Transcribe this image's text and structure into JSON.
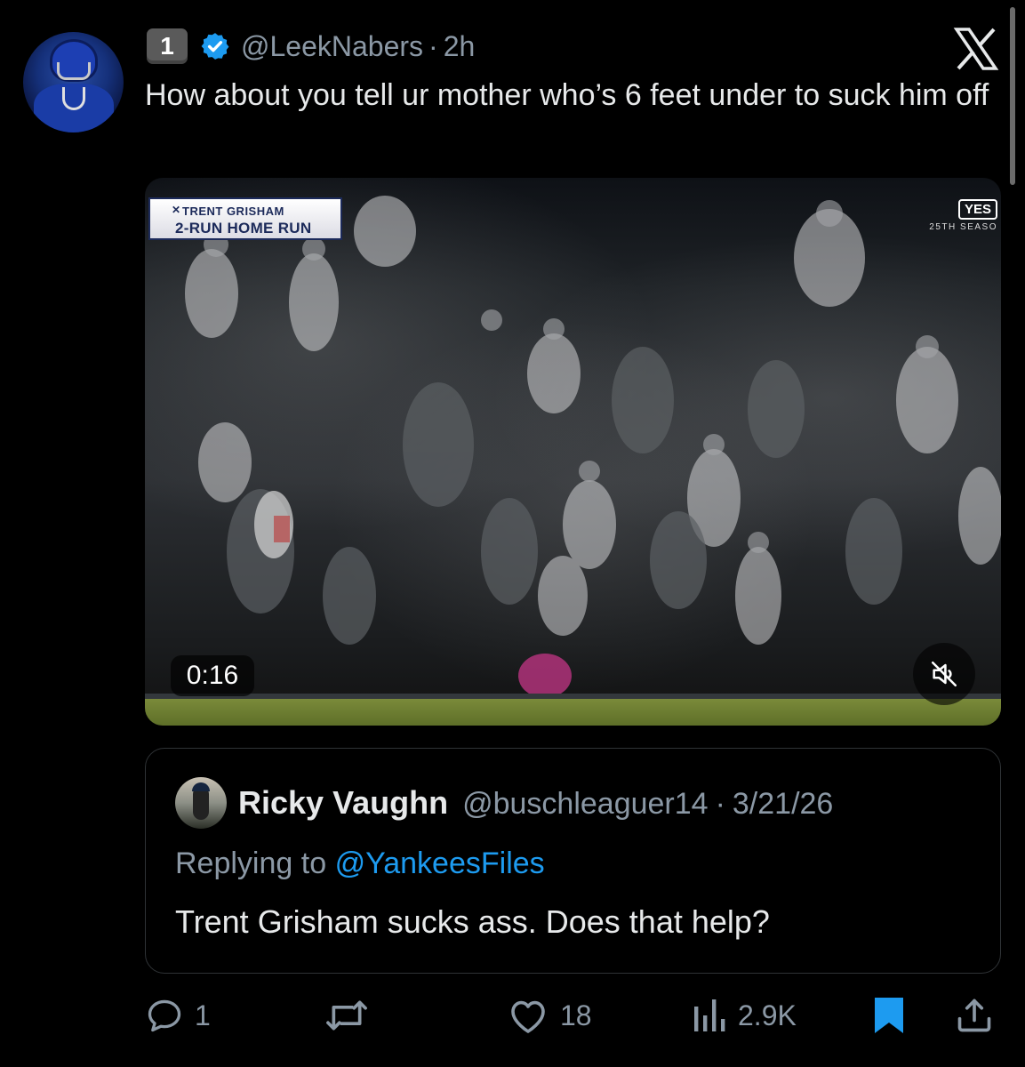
{
  "tweet": {
    "rank_badge": "1",
    "handle": "@LeekNabers",
    "separator": "·",
    "time": "2h",
    "text": "How about you tell ur mother who’s 6 feet under to suck him off"
  },
  "video": {
    "lower_third_line1": "TRENT GRISHAM",
    "lower_third_line2": "2-RUN HOME RUN",
    "network_logo": "YES",
    "network_sub": "25TH SEASO",
    "duration": "0:16"
  },
  "quote": {
    "name": "Ricky Vaughn",
    "handle": "@buschleaguer14",
    "separator": "·",
    "date": "3/21/26",
    "replying_prefix": "Replying to",
    "replying_to": "@YankeesFiles",
    "text": "Trent Grisham sucks ass.  Does that help?"
  },
  "actions": {
    "replies": "1",
    "likes": "18",
    "views": "2.9K"
  },
  "colors": {
    "background": "#000000",
    "text": "#e7e9ea",
    "muted": "#8b98a5",
    "accent": "#1d9bf0",
    "bookmark": "#1d9bf0",
    "verified": "#1d9bf0"
  },
  "icons": [
    "rank-badge",
    "verified-icon",
    "x-logo-icon",
    "mute-icon",
    "reply-icon",
    "retweet-icon",
    "like-icon",
    "views-icon",
    "bookmark-icon",
    "share-icon"
  ]
}
